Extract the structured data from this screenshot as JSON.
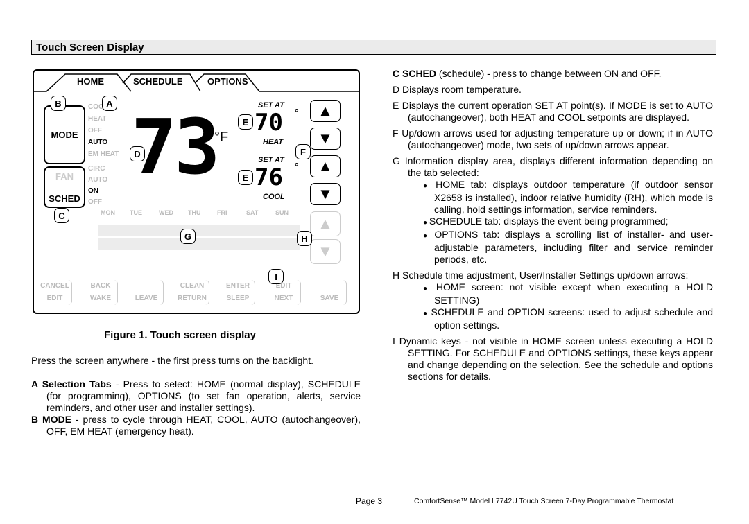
{
  "section_title": "Touch Screen Display",
  "figure": {
    "tabs": [
      "HOME",
      "SCHEDULE",
      "OPTIONS"
    ],
    "mode_button": "MODE",
    "mode_options": [
      {
        "t": "COOL",
        "on": false
      },
      {
        "t": "HEAT",
        "on": false
      },
      {
        "t": "OFF",
        "on": false
      },
      {
        "t": "AUTO",
        "on": true
      },
      {
        "t": "EM HEAT",
        "on": false
      }
    ],
    "fan_label": "FAN",
    "sched_button": "SCHED",
    "fan_options": [
      {
        "t": "CIRC",
        "on": false
      },
      {
        "t": "AUTO",
        "on": false
      },
      {
        "t": "ON",
        "on": true
      },
      {
        "t": "OFF",
        "on": false
      }
    ],
    "room_temp": "73",
    "room_unit": "°F",
    "set_at": "SET AT",
    "heat_setpoint": "70",
    "heat_label": "HEAT",
    "cool_setpoint": "76",
    "cool_label": "COOL",
    "deg": "°",
    "days": [
      "MON",
      "TUE",
      "WED",
      "THU",
      "FRI",
      "SAT",
      "SUN"
    ],
    "keys": [
      [
        "CANCEL",
        "EDIT"
      ],
      [
        "BACK",
        "WAKE"
      ],
      [
        "",
        "LEAVE"
      ],
      [
        "CLEAN",
        "RETURN"
      ],
      [
        "ENTER",
        "SLEEP"
      ],
      [
        "EDIT",
        "NEXT"
      ],
      [
        "",
        "SAVE"
      ]
    ],
    "callouts": {
      "A": "A",
      "B": "B",
      "C": "C",
      "D": "D",
      "E": "E",
      "F": "F",
      "G": "G",
      "H": "H",
      "I": "I"
    }
  },
  "caption": "Figure 1. Touch  screen display",
  "left": {
    "intro": "Press the screen anywhere - the first press turns on the backlight.",
    "A_key": "A Selection Tabs",
    "A_text": " - Press to select: HOME (normal display), SCHEDULE (for programming), OPTIONS (to set fan operation, alerts, service reminders, and other user and installer settings).",
    "B_key": "B MODE",
    "B_text": " - press to cycle through HEAT, COOL, AUTO (autochangeover), OFF, EM HEAT (emergency heat)."
  },
  "right": {
    "C_key": "C SCHED",
    "C_text": " (schedule) - press to change between ON and OFF.",
    "D": "D Displays room temperature.",
    "E": "E Displays the current operation SET AT point(s). If MODE is set to AUTO (autochangeover), both HEAT and COOL setpoints are displayed.",
    "F": "F Up/down arrows used for adjusting temperature up or down; if in AUTO (autochangeover) mode, two sets of up/down arrows appear.",
    "G": "G Information display area, displays different information depending on the tab selected:",
    "G_bullets": [
      "HOME tab: displays outdoor temperature (if outdoor sensor X2658 is installed), indoor relative humidity (RH), which mode is calling, hold settings information, service reminders.",
      "SCHEDULE tab: displays the event being programmed;",
      "OPTIONS tab: displays a scrolling list of installer- and user-adjustable parameters, including filter and service reminder periods, etc."
    ],
    "H": "H Schedule time adjustment, User/Installer Settings up/down arrows:",
    "H_bullets": [
      "HOME screen: not visible except when executing a HOLD SETTING)",
      "SCHEDULE and OPTION screens: used to adjust schedule and option settings."
    ],
    "I": "I Dynamic keys - not visible in HOME screen unless executing a HOLD SETTING. For SCHEDULE and OPTIONS settings, these keys appear and change depending on the selection. See the schedule and options sections for details."
  },
  "footer": {
    "page": "Page 3",
    "product": "ComfortSense™ Model L7742U Touch Screen 7-Day Programmable Thermostat"
  }
}
